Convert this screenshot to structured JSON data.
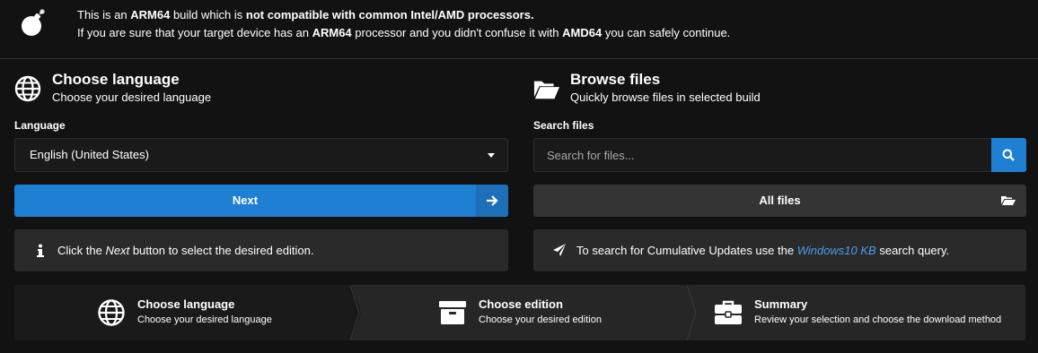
{
  "warning": {
    "icon": "bomb-icon",
    "line1_pre": "This is an ",
    "line1_arch": "ARM64",
    "line1_mid": " build which is ",
    "line1_strong": "not compatible with common Intel/AMD processors.",
    "line2_pre": "If you are sure that your target device has an ",
    "line2_arch": "ARM64",
    "line2_mid": " processor and you didn't confuse it with ",
    "line2_other": "AMD64",
    "line2_post": " you can safely continue."
  },
  "language_section": {
    "icon": "globe-icon",
    "title": "Choose language",
    "subtitle": "Choose your desired language",
    "field_label": "Language",
    "selected": "English (United States)",
    "next_button": "Next",
    "info_pre": "Click the ",
    "info_em": "Next",
    "info_post": " button to select the desired edition."
  },
  "files_section": {
    "icon": "folder-open-icon",
    "title": "Browse files",
    "subtitle": "Quickly browse files in selected build",
    "field_label": "Search files",
    "search_placeholder": "Search for files...",
    "all_files_button": "All files",
    "info_pre": "To search for Cumulative Updates use the ",
    "info_link": "Windows10 KB",
    "info_post": " search query."
  },
  "steps": [
    {
      "icon": "globe-icon",
      "title": "Choose language",
      "subtitle": "Choose your desired language",
      "active": true
    },
    {
      "icon": "archive-box-icon",
      "title": "Choose edition",
      "subtitle": "Choose your desired edition",
      "active": false
    },
    {
      "icon": "briefcase-icon",
      "title": "Summary",
      "subtitle": "Review your selection and choose the download method",
      "active": false
    }
  ],
  "colors": {
    "background": "#121212",
    "accent": "#1f7fd2",
    "panel": "#2a2a2a",
    "link": "#4d9ee8"
  }
}
